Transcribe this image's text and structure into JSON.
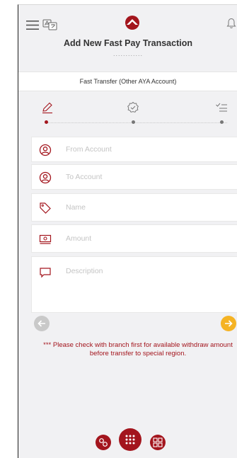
{
  "header": {
    "title": "Add New Fast Pay Transaction",
    "title_dots": "............"
  },
  "transfer_type": "Fast Transfer (Other AYA Account)",
  "steps": [
    {
      "name": "edit",
      "icon": "pencil-icon",
      "active": true
    },
    {
      "name": "verify",
      "icon": "badge-check-icon",
      "active": false
    },
    {
      "name": "confirm",
      "icon": "list-check-icon",
      "active": false
    }
  ],
  "form": {
    "from_account": "From Account",
    "to_account": "To Account",
    "name": "Name",
    "amount": "Amount",
    "description": "Description"
  },
  "notice": "*** Please check with branch first for available withdraw amount before transfer to special region.",
  "colors": {
    "brand": "#a3151d",
    "accent": "#f5b324",
    "muted_button": "#c9c9c9",
    "background": "#f1f1f3"
  },
  "icons": {
    "menu": "hamburger-menu-icon",
    "language": "language-toggle-icon",
    "logo": "aya-logo",
    "notification": "bell-icon",
    "back": "arrow-left-icon",
    "next": "arrow-right-icon",
    "bottom_left": "transfer-icon",
    "bottom_center": "grid-dots-icon",
    "bottom_right": "qr-code-icon"
  }
}
